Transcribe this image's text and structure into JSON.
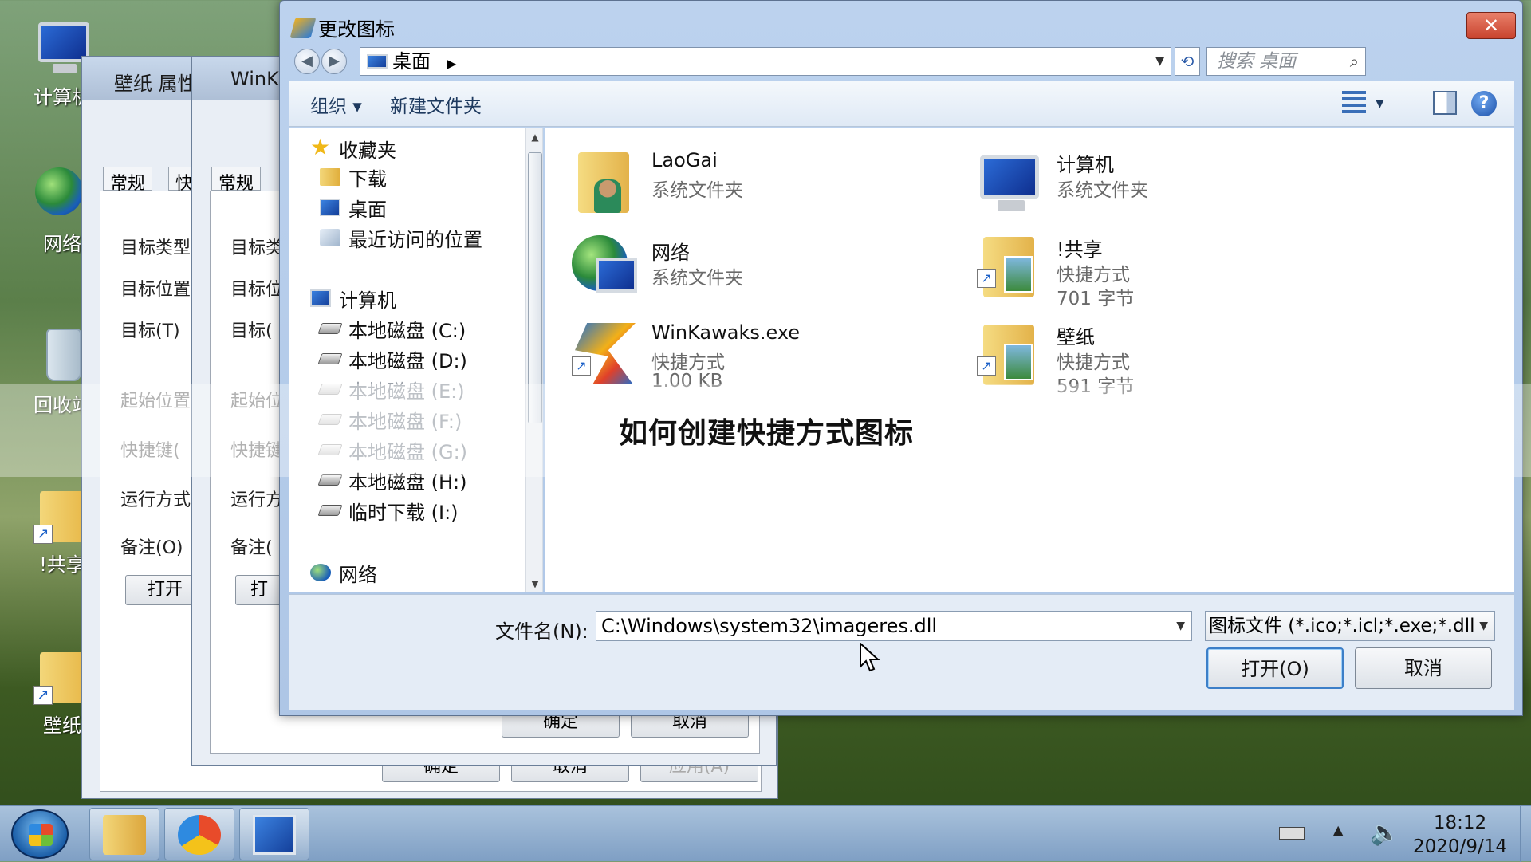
{
  "desktop": {
    "icons": [
      {
        "label": "计算机"
      },
      {
        "label": "网络"
      },
      {
        "label": "回收站"
      },
      {
        "label": "!共享"
      },
      {
        "label": "壁纸"
      }
    ]
  },
  "background_windows": {
    "win1": {
      "title": "壁纸 属性",
      "tab_general": "常规",
      "tab_shortcut": "快",
      "fields": [
        "目标类型",
        "目标位置",
        "目标(T)",
        "起始位置",
        "快捷键(",
        "运行方式",
        "备注(O)"
      ],
      "open_btn": "打开",
      "ok_btn": "确定",
      "cancel_btn": "取消",
      "apply_btn": "应用(A)"
    },
    "win2": {
      "title": "WinK",
      "tab_general": "常规",
      "fields": [
        "目标类",
        "目标位",
        "目标(",
        "起始位",
        "快捷键",
        "运行方",
        "备注("
      ],
      "open_btn": "打",
      "ok_btn": "确定",
      "cancel_btn": "取消"
    }
  },
  "dialog": {
    "title": "更改图标",
    "close_glyph": "✕",
    "address": {
      "location": "桌面",
      "search_placeholder": "搜索 桌面"
    },
    "toolbar": {
      "organize": "组织 ▾",
      "new_folder": "新建文件夹",
      "help": "?"
    },
    "nav": {
      "favorites": "收藏夹",
      "favorites_items": [
        "下载",
        "桌面",
        "最近访问的位置"
      ],
      "computer": "计算机",
      "drives": [
        {
          "label": "本地磁盘 (C:)",
          "dim": false
        },
        {
          "label": "本地磁盘 (D:)",
          "dim": false
        },
        {
          "label": "本地磁盘 (E:)",
          "dim": true
        },
        {
          "label": "本地磁盘 (F:)",
          "dim": true
        },
        {
          "label": "本地磁盘 (G:)",
          "dim": true
        },
        {
          "label": "本地磁盘 (H:)",
          "dim": false
        },
        {
          "label": "临时下载 (I:)",
          "dim": false
        }
      ],
      "network": "网络"
    },
    "files": [
      {
        "name": "LaoGai",
        "type": "系统文件夹",
        "size": ""
      },
      {
        "name": "计算机",
        "type": "系统文件夹",
        "size": ""
      },
      {
        "name": "网络",
        "type": "系统文件夹",
        "size": ""
      },
      {
        "name": "!共享",
        "type": "快捷方式",
        "size": "701 字节"
      },
      {
        "name": "WinKawaks.exe",
        "type": "快捷方式",
        "size": "1.00 KB"
      },
      {
        "name": "壁纸",
        "type": "快捷方式",
        "size": "591 字节"
      }
    ],
    "filename_label": "文件名(N):",
    "filename_value": "C:\\Windows\\system32\\imageres.dll",
    "filetype_value": "图标文件 (*.ico;*.icl;*.exe;*.dll",
    "open_btn": "打开(O)",
    "cancel_btn": "取消"
  },
  "overlay_caption": "如何创建快捷方式图标",
  "taskbar": {
    "time": "18:12",
    "date": "2020/9/14"
  }
}
